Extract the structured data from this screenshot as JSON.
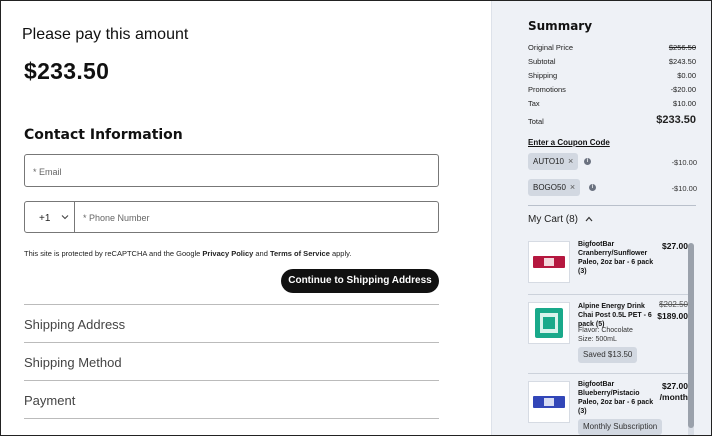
{
  "left": {
    "pay_heading": "Please pay this amount",
    "amount": "$233.50",
    "contact_title": "Contact Information",
    "email_placeholder": "* Email",
    "country_code": "+1",
    "phone_placeholder": "* Phone Number",
    "recaptcha": {
      "prefix": "This site is protected by reCAPTCHA and the Google ",
      "privacy": "Privacy Policy",
      "and": " and ",
      "terms": "Terms of Service",
      "suffix": " apply."
    },
    "continue_label": "Continue to Shipping Address",
    "sections": [
      "Shipping Address",
      "Shipping Method",
      "Payment"
    ]
  },
  "summary": {
    "title": "Summary",
    "rows": [
      {
        "label": "Original Price",
        "value": "$256.50",
        "struck": true
      },
      {
        "label": "Subtotal",
        "value": "$243.50"
      },
      {
        "label": "Shipping",
        "value": "$0.00"
      },
      {
        "label": "Promotions",
        "value": "-$20.00"
      },
      {
        "label": "Tax",
        "value": "$10.00"
      }
    ],
    "total_label": "Total",
    "total_value": "$233.50",
    "coupon_link": "Enter a Coupon Code",
    "coupons": [
      {
        "code": "AUTO10",
        "value": "-$10.00"
      },
      {
        "code": "BOGO50",
        "value": "-$10.00"
      }
    ],
    "cart_title": "My Cart (8)"
  },
  "cart": {
    "items": [
      {
        "name": "BigfootBar Cranberry/Sunflower Paleo, 2oz bar - 6 pack (3)",
        "price": "$27.00",
        "thumb_color": "#b5173f"
      },
      {
        "name": "Alpine Energy Drink Chai Post 0.5L PET - 6 pack (5)",
        "original": "$202.50",
        "price": "$189.00",
        "flavor": "Flavor: Chocolate",
        "size": "Size: 500mL",
        "saved": "Saved $13.50",
        "thumb_color": "#19a98a"
      },
      {
        "name": "BigfootBar Blueberry/Pistacio Paleo, 2oz bar - 6 pack (3)",
        "price": "$27.00 /month",
        "saved": "Monthly Subscription",
        "thumb_color": "#3246b8"
      }
    ]
  }
}
